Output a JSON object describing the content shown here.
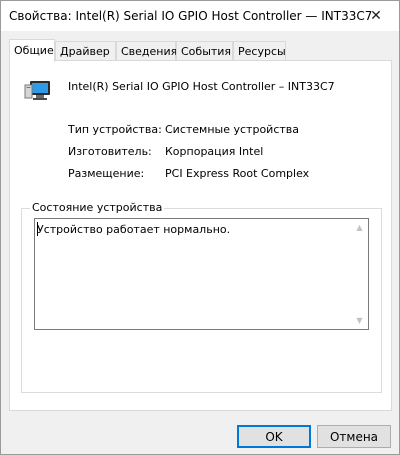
{
  "window": {
    "title": "Свойства: Intel(R) Serial IO GPIO Host Controller — INT33C7",
    "close_glyph": "✕"
  },
  "tabs": [
    {
      "label": "Общие",
      "active": true
    },
    {
      "label": "Драйвер",
      "active": false
    },
    {
      "label": "Сведения",
      "active": false
    },
    {
      "label": "События",
      "active": false
    },
    {
      "label": "Ресурсы",
      "active": false
    }
  ],
  "device": {
    "icon": "monitor-device-icon",
    "name": "Intel(R) Serial IO GPIO Host Controller – INT33C7"
  },
  "properties": [
    {
      "label": "Тип устройства:",
      "value": "Системные устройства"
    },
    {
      "label": "Изготовитель:",
      "value": "Корпорация Intel"
    },
    {
      "label": "Размещение:",
      "value": "PCI Express Root Complex"
    }
  ],
  "status": {
    "legend": "Состояние устройства",
    "text": "Устройство работает нормально."
  },
  "buttons": {
    "ok": "OK",
    "cancel": "Отмена"
  },
  "colors": {
    "default_button_border": "#0078d7",
    "window_background": "#f0f0f0"
  }
}
